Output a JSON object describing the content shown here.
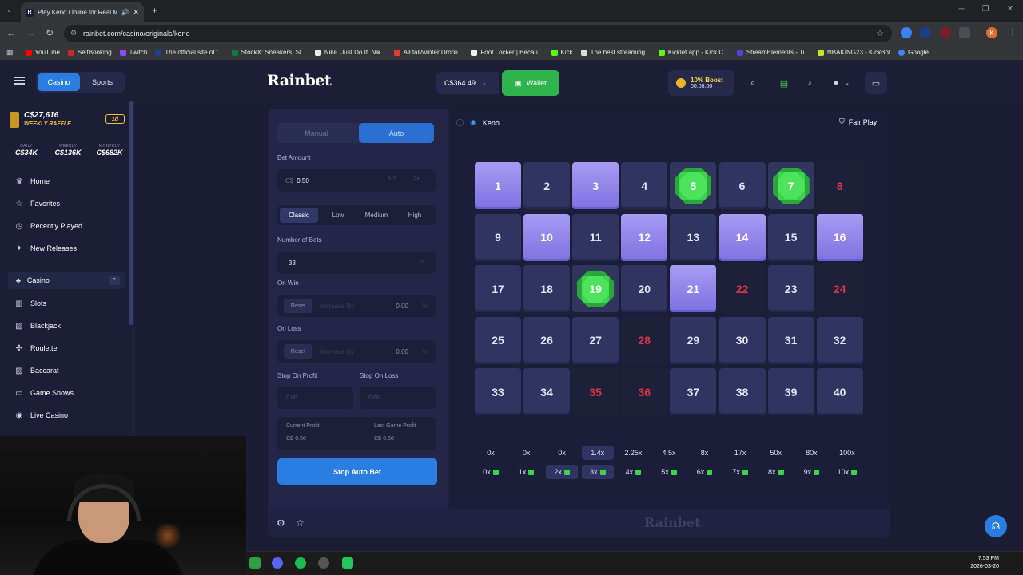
{
  "browser": {
    "tab_title": "Play Keno Online for Real M",
    "url": "rainbet.com/casino/originals/keno",
    "bookmarks": [
      "YouTube",
      "SelfBooking",
      "Twitch",
      "The official site of t...",
      "StockX: Sneakers, St...",
      "Nike. Just Do It. Nik...",
      "All fall/winter Dropli...",
      "Foot Locker | Becau...",
      "Kick",
      "The best streaming...",
      "Kicklet.app - Kick C...",
      "StreamElements - Ti...",
      "NBAKING23 - KickBot",
      "Google"
    ],
    "profile_letter": "K"
  },
  "header": {
    "casino_label": "Casino",
    "sports_label": "Sports",
    "logo": "Rainbet",
    "balance": "C$364.49",
    "wallet_label": "Wallet",
    "boost_title": "10% Boost",
    "boost_timer": "00:08:00"
  },
  "sidebar": {
    "raffle_amount": "C$27,616",
    "raffle_label": "WEEKLY RAFFLE",
    "raffle_badge": "1d",
    "pools": [
      {
        "label": "DAILY",
        "value": "C$34K"
      },
      {
        "label": "WEEKLY",
        "value": "C$136K"
      },
      {
        "label": "MONTHLY",
        "value": "C$682K"
      }
    ],
    "nav": [
      "Home",
      "Favorites",
      "Recently Played",
      "New Releases"
    ],
    "casino_section": "Casino",
    "games": [
      "Slots",
      "Blackjack",
      "Roulette",
      "Baccarat",
      "Game Shows",
      "Live Casino"
    ]
  },
  "controls": {
    "manual_label": "Manual",
    "auto_label": "Auto",
    "bet_amount_label": "Bet Amount",
    "bet_currency": "C$",
    "bet_value": "0.50",
    "half_label": "1/2",
    "double_label": "2x",
    "risk_levels": [
      "Classic",
      "Low",
      "Medium",
      "High"
    ],
    "risk_selected": "Classic",
    "num_bets_label": "Number of Bets",
    "num_bets_value": "33",
    "infinity": "∞",
    "on_win_label": "On Win",
    "on_loss_label": "On Loss",
    "reset_label": "Reset",
    "increase_by_placeholder": "Increase By",
    "win_value": "0.00",
    "loss_value": "0.00",
    "percent": "%",
    "stop_profit_label": "Stop On Profit",
    "stop_loss_label": "Stop On Loss",
    "stop_profit_placeholder": "0.00",
    "stop_loss_placeholder": "0.00",
    "current_profit_label": "Current Profit",
    "current_profit_value": "C$-0.50",
    "last_game_label": "Last Game Profit",
    "last_game_value": "C$-0.50",
    "stop_button": "Stop Auto Bet"
  },
  "board": {
    "game_name": "Keno",
    "fair_play": "Fair Play",
    "selected": [
      1,
      3,
      10,
      12,
      14,
      16,
      21
    ],
    "hits": [
      5,
      7,
      19
    ],
    "misses": [
      8,
      22,
      24,
      28,
      35,
      36
    ],
    "payouts": [
      "0x",
      "0x",
      "0x",
      "1.4x",
      "2.25x",
      "4.5x",
      "8x",
      "17x",
      "50x",
      "80x",
      "100x"
    ],
    "payout_highlight": 3,
    "hit_counts": [
      "0x",
      "1x",
      "2x",
      "3x",
      "4x",
      "5x",
      "6x",
      "7x",
      "8x",
      "9x",
      "10x"
    ],
    "hit_highlight": [
      2,
      3
    ],
    "watermark": "Rainbet"
  },
  "taskbar": {
    "time": "7:53 PM",
    "date": "2026-03-20"
  }
}
